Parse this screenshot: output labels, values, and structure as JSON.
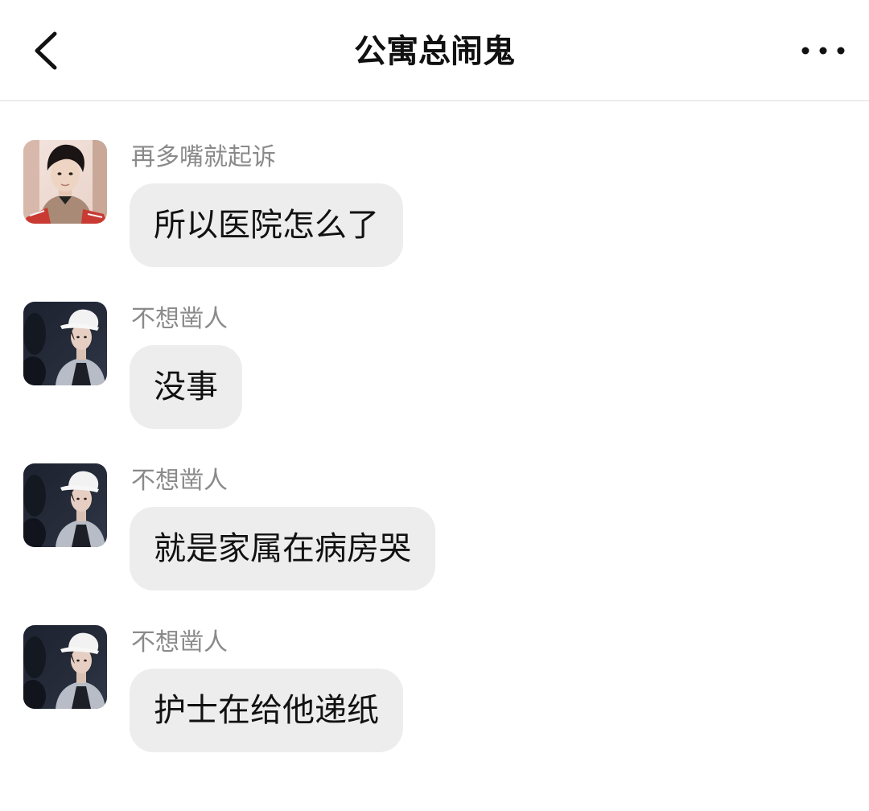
{
  "header": {
    "title": "公寓总闹鬼"
  },
  "messages": [
    {
      "sender": "再多嘴就起诉",
      "text": "所以医院怎么了",
      "avatar": "avatar-boy-red-sweater"
    },
    {
      "sender": "不想凿人",
      "text": "没事",
      "avatar": "avatar-boy-white-cap"
    },
    {
      "sender": "不想凿人",
      "text": "就是家属在病房哭",
      "avatar": "avatar-boy-white-cap"
    },
    {
      "sender": "不想凿人",
      "text": "护士在给他递纸",
      "avatar": "avatar-boy-white-cap"
    }
  ],
  "colors": {
    "bubble": "#ededed",
    "sender_text": "#8a8a8a",
    "text": "#111111",
    "divider": "#ececec"
  }
}
